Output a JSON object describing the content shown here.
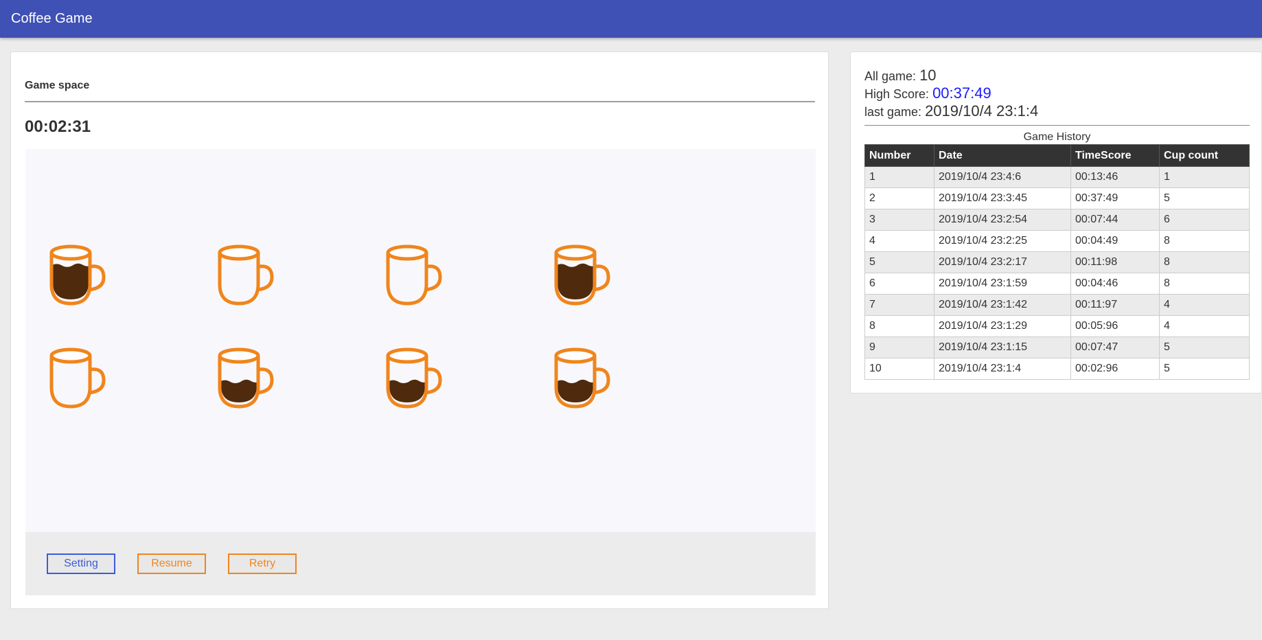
{
  "app": {
    "title": "Coffee Game"
  },
  "game": {
    "heading": "Game space",
    "timer": "00:02:31",
    "cups": [
      {
        "fill": 0.75
      },
      {
        "fill": 0
      },
      {
        "fill": 0
      },
      {
        "fill": 0.75
      },
      {
        "fill": 0
      },
      {
        "fill": 0.45
      },
      {
        "fill": 0.45
      },
      {
        "fill": 0.45
      }
    ],
    "buttons": {
      "setting": "Setting",
      "resume": "Resume",
      "retry": "Retry"
    },
    "colors": {
      "cup": "#f0851c",
      "coffee": "#4f2a0c",
      "setting": "#3c5bd8"
    }
  },
  "stats": {
    "all_game_label": "All game:",
    "all_game_value": "10",
    "high_score_label": "High Score:",
    "high_score_value": "00:37:49",
    "last_game_label": "last game:",
    "last_game_value": "2019/10/4 23:1:4"
  },
  "history": {
    "caption": "Game History",
    "columns": [
      "Number",
      "Date",
      "TimeScore",
      "Cup count"
    ],
    "rows": [
      [
        "1",
        "2019/10/4 23:4:6",
        "00:13:46",
        "1"
      ],
      [
        "2",
        "2019/10/4 23:3:45",
        "00:37:49",
        "5"
      ],
      [
        "3",
        "2019/10/4 23:2:54",
        "00:07:44",
        "6"
      ],
      [
        "4",
        "2019/10/4 23:2:25",
        "00:04:49",
        "8"
      ],
      [
        "5",
        "2019/10/4 23:2:17",
        "00:11:98",
        "8"
      ],
      [
        "6",
        "2019/10/4 23:1:59",
        "00:04:46",
        "8"
      ],
      [
        "7",
        "2019/10/4 23:1:42",
        "00:11:97",
        "4"
      ],
      [
        "8",
        "2019/10/4 23:1:29",
        "00:05:96",
        "4"
      ],
      [
        "9",
        "2019/10/4 23:1:15",
        "00:07:47",
        "5"
      ],
      [
        "10",
        "2019/10/4 23:1:4",
        "00:02:96",
        "5"
      ]
    ]
  }
}
